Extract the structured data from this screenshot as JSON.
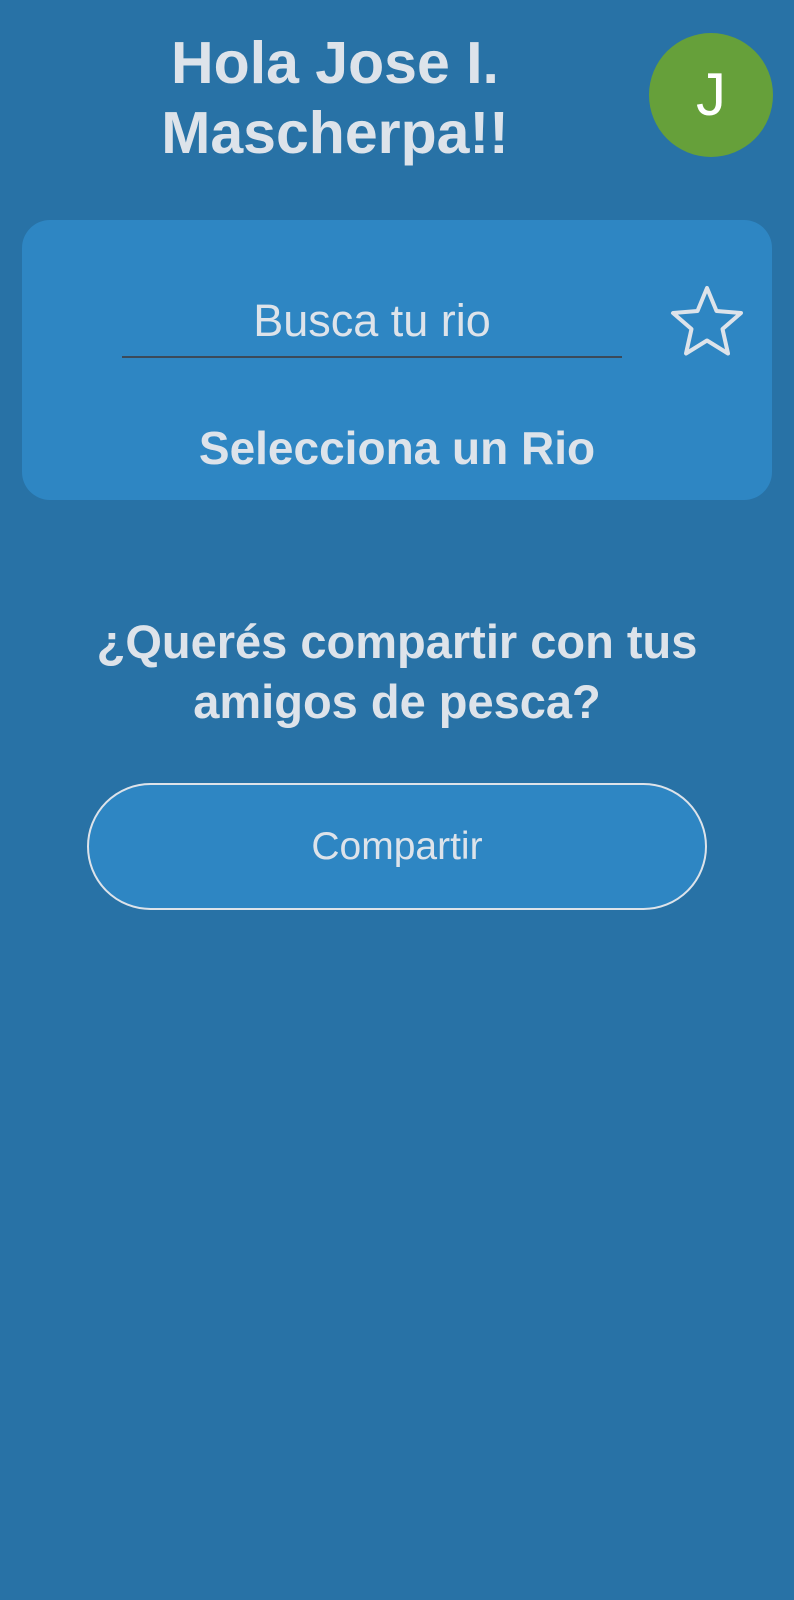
{
  "header": {
    "greeting": "Hola Jose I. Mascherpa!!",
    "avatar_initial": "J",
    "avatar_color": "#66a03a"
  },
  "river_card": {
    "search_placeholder": "Busca tu rio",
    "search_value": "",
    "favorite_icon": "star-outline-icon",
    "select_label": "Selecciona un Rio"
  },
  "share": {
    "question": "¿Querés compartir con tus amigos de pesca?",
    "button_label": "Compartir"
  },
  "colors": {
    "background": "#2872a6",
    "card": "#2e86c3",
    "text": "#dde3ea"
  }
}
